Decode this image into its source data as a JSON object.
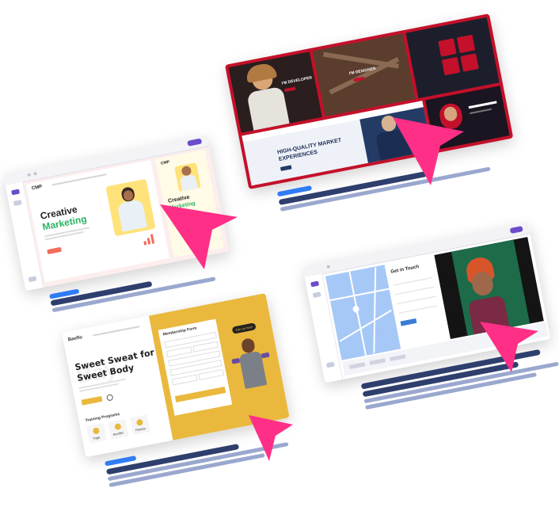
{
  "palette": {
    "pointer": "#ff2f87",
    "blue_bar": "#2f7cf6",
    "navy_bar": "#2e3e6d",
    "lavender_bar": "#9aa8cf",
    "crimson": "#c4102a",
    "mustard": "#e9b83d",
    "green_accent": "#28b463",
    "purple_ui": "#6b4cc9"
  },
  "card_marketing": {
    "brand": "CMP",
    "headline_1": "Creative",
    "headline_2": "Marketing",
    "preview_brand": "CMP",
    "preview_h1": "Creative",
    "preview_h2": "Marketing"
  },
  "card_designer": {
    "tag_developer": "I'M DEVELOPER",
    "tag_designer": "I'M DESIGNER",
    "headline_1": "HIGH-QUALITY MARKET",
    "headline_2": "EXPERIENCES"
  },
  "card_fitness": {
    "logo": "Baeflo",
    "headline_1": "Sweet Sweat for",
    "headline_2": "Sweet Body",
    "watermark": "Bay",
    "form_title": "Membership Form",
    "badge": "Join us now!",
    "section": "Training Programs",
    "program_1": "Yoga",
    "program_2": "Aerobic",
    "program_3": "Fitness"
  },
  "card_contact": {
    "title": "Get in Touch"
  }
}
